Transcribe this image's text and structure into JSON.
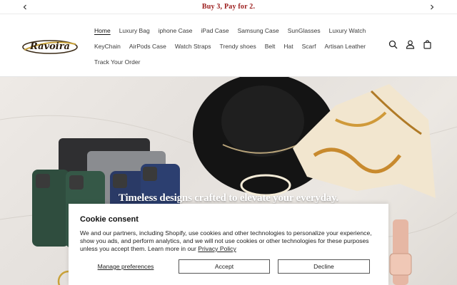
{
  "announcement": {
    "text": "Buy 3, Pay for 2."
  },
  "header": {
    "logo_text": "Ravoira",
    "nav_row1": [
      "Home",
      "Luxury Bag",
      "iphone Case",
      "iPad Case",
      "Samsung Case",
      "SunGlasses",
      "Luxury Watch"
    ],
    "nav_row2": [
      "KeyChain",
      "AirPods Case",
      "Watch Straps",
      "Trendy shoes",
      "Belt",
      "Hat",
      "Scarf",
      "Artisan Leather"
    ],
    "nav_row3": [
      "Track Your Order"
    ],
    "active_item": "Home",
    "icons": [
      "search-icon",
      "account-icon",
      "cart-icon"
    ]
  },
  "hero": {
    "heading": "Timeless designs crafted to elevate your everyday."
  },
  "cookie": {
    "title": "Cookie consent",
    "body": "We and our partners, including Shopify, use cookies and other technologies to personalize your experience, show you ads, and perform analytics, and we will not use cookies or other technologies for these purposes unless you accept them. Learn more in our",
    "link": "Privacy Policy",
    "manage_label": "Manage preferences",
    "accept_label": "Accept",
    "decline_label": "Decline"
  },
  "colors": {
    "announcement_text": "#9b1c1c",
    "hero_bg": "#e6e2dd",
    "button_border": "#555555"
  }
}
